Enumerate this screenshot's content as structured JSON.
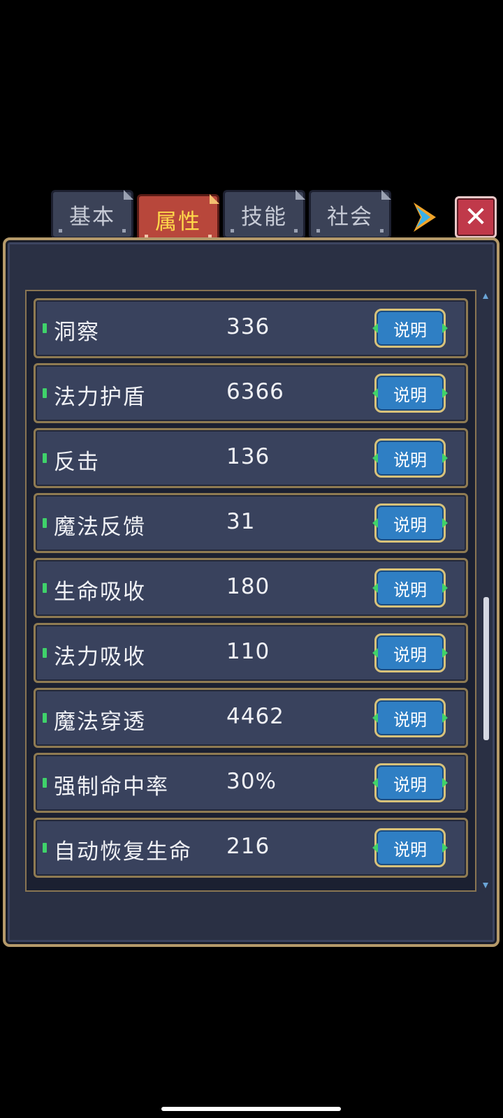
{
  "tabs": [
    {
      "label": "基本",
      "active": false
    },
    {
      "label": "属性",
      "active": true
    },
    {
      "label": "技能",
      "active": false
    },
    {
      "label": "社会",
      "active": false
    }
  ],
  "icons": {
    "next": "arrow-right-icon",
    "close": "close-icon"
  },
  "close_glyph": "✕",
  "info_label": "说明",
  "attributes": [
    {
      "name": "洞察",
      "value": "336"
    },
    {
      "name": "法力护盾",
      "value": "6366"
    },
    {
      "name": "反击",
      "value": "136"
    },
    {
      "name": "魔法反馈",
      "value": "31"
    },
    {
      "name": "生命吸收",
      "value": "180"
    },
    {
      "name": "法力吸收",
      "value": "110"
    },
    {
      "name": "魔法穿透",
      "value": "4462"
    },
    {
      "name": "强制命中率",
      "value": "30%"
    },
    {
      "name": "自动恢复生命",
      "value": "216"
    }
  ],
  "colors": {
    "panel_bg": "#2a3044",
    "row_bg": "#39425d",
    "gold_border": "#8f7b52",
    "active_tab": "#b8473b",
    "active_tab_text": "#ffd84a",
    "info_button": "#2f7fc4",
    "marker_green": "#3fd26a"
  }
}
